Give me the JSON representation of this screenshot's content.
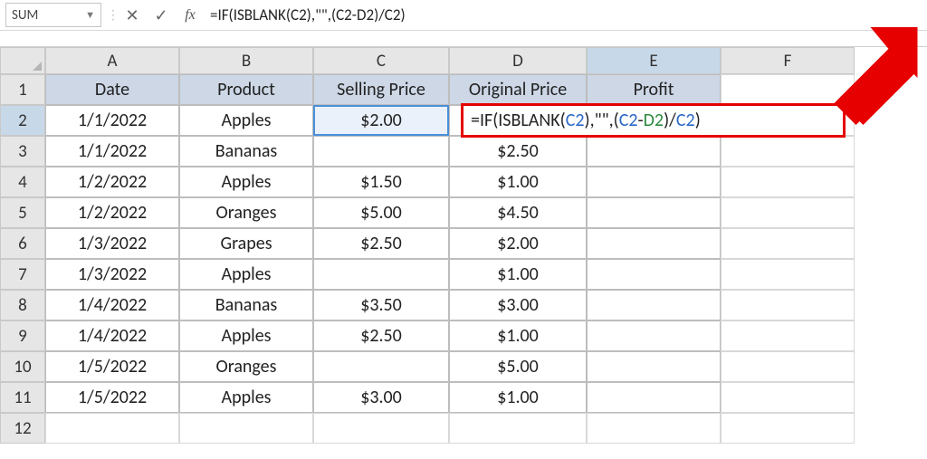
{
  "formula_bar": {
    "namebox": "SUM",
    "fx_label": "fx",
    "formula_text": "=IF(ISBLANK(C2),\"\",(C2-D2)/C2)"
  },
  "columns": [
    "A",
    "B",
    "C",
    "D",
    "E",
    "F"
  ],
  "rows_labels": [
    "1",
    "2",
    "3",
    "4",
    "5",
    "6",
    "7",
    "8",
    "9",
    "10",
    "11",
    "12"
  ],
  "headers": {
    "A": "Date",
    "B": "Product",
    "C": "Selling Price",
    "D": "Original Price",
    "E": "Profit"
  },
  "overlay_formula": {
    "prefix": "=IF(ISBLANK(",
    "c_ref": "C2",
    "mid1": "),\"\",(",
    "c_ref2": "C2",
    "minus": "-",
    "d_ref": "D2",
    "mid2": ")/",
    "c_ref3": "C2",
    "end": ")"
  },
  "chart_data": {
    "type": "table",
    "columns": [
      "Date",
      "Product",
      "Selling Price",
      "Original Price",
      "Profit"
    ],
    "rows": [
      {
        "Date": "1/1/2022",
        "Product": "Apples",
        "Selling Price": "$2.00",
        "Original Price": "",
        "Profit": ""
      },
      {
        "Date": "1/1/2022",
        "Product": "Bananas",
        "Selling Price": "",
        "Original Price": "$2.50",
        "Profit": ""
      },
      {
        "Date": "1/2/2022",
        "Product": "Apples",
        "Selling Price": "$1.50",
        "Original Price": "$1.00",
        "Profit": ""
      },
      {
        "Date": "1/2/2022",
        "Product": "Oranges",
        "Selling Price": "$5.00",
        "Original Price": "$4.50",
        "Profit": ""
      },
      {
        "Date": "1/3/2022",
        "Product": "Grapes",
        "Selling Price": "$2.50",
        "Original Price": "$2.00",
        "Profit": ""
      },
      {
        "Date": "1/3/2022",
        "Product": "Apples",
        "Selling Price": "",
        "Original Price": "$1.00",
        "Profit": ""
      },
      {
        "Date": "1/4/2022",
        "Product": "Bananas",
        "Selling Price": "$3.50",
        "Original Price": "$3.00",
        "Profit": ""
      },
      {
        "Date": "1/4/2022",
        "Product": "Apples",
        "Selling Price": "$2.50",
        "Original Price": "$1.00",
        "Profit": ""
      },
      {
        "Date": "1/5/2022",
        "Product": "Oranges",
        "Selling Price": "",
        "Original Price": "$5.00",
        "Profit": ""
      },
      {
        "Date": "1/5/2022",
        "Product": "Apples",
        "Selling Price": "$3.00",
        "Original Price": "$1.00",
        "Profit": ""
      }
    ]
  }
}
